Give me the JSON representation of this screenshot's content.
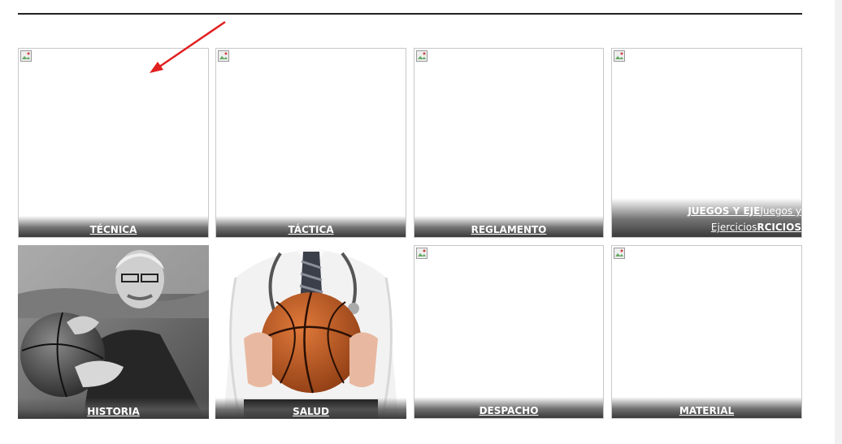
{
  "tiles": [
    {
      "label": "TÉCNICA"
    },
    {
      "label": "TÁCTICA"
    },
    {
      "label": "REGLAMENTO"
    },
    {
      "label_part1": "JUEGOS Y EJE",
      "label_part2": "Juegos y",
      "label_part3": "Ejercicios",
      "label_part4": "RCICIOS"
    },
    {
      "label": "HISTORIA"
    },
    {
      "label": "SALUD"
    },
    {
      "label": "DESPACHO"
    },
    {
      "label": "MATERIAL"
    }
  ],
  "colors": {
    "caption_text": "#ffffff",
    "annotation_arrow": "#e02020",
    "tile_border": "#c8c8c8"
  }
}
